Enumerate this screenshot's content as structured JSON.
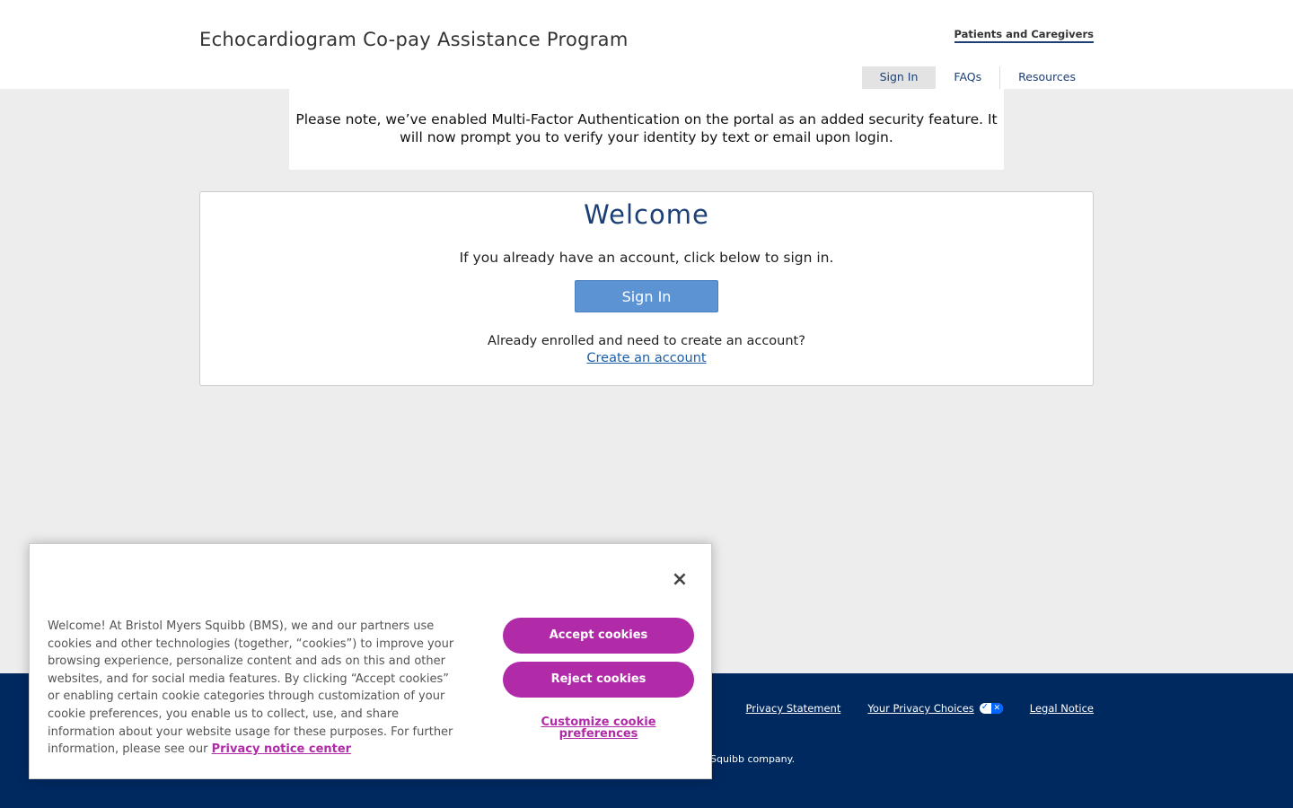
{
  "header": {
    "title": "Echocardiogram Co-pay Assistance Program",
    "audience_link": "Patients and Caregivers",
    "nav": [
      {
        "label": "Sign In",
        "active": true
      },
      {
        "label": "FAQs",
        "active": false
      },
      {
        "label": "Resources",
        "active": false
      }
    ]
  },
  "notice": {
    "text": "Please note, we’ve enabled Multi-Factor Authentication on the portal as an added security feature. It will now prompt you to verify your identity by text or email upon login."
  },
  "welcome": {
    "title": "Welcome",
    "intro": "If you already have an account, click below to sign in.",
    "sign_in_label": "Sign In",
    "enroll_text": "Already enrolled and need to create an account?",
    "create_account_label": "Create an account"
  },
  "footer": {
    "links": {
      "privacy_statement": "Privacy Statement",
      "privacy_choices": "Your Privacy Choices",
      "legal_notice": "Legal Notice"
    },
    "copyright_fragment": "Squibb company."
  },
  "cookie_banner": {
    "text": "Welcome! At Bristol Myers Squibb (BMS), we and our partners use cookies and other technologies (together, “cookies”) to improve your browsing experience, personalize content and ads on this and other websites, and for social media features. By clicking “Accept cookies” or enabling certain cookie categories through customization of your cookie preferences, you enable us to collect, use, and share information about your website usage for these purposes. For further information, please see our",
    "privacy_link": "Privacy notice center",
    "accept_label": "Accept cookies",
    "reject_label": "Reject cookies",
    "customize_label": "Customize cookie preferences",
    "close_icon": "×"
  },
  "colors": {
    "brand_navy": "#002960",
    "nav_text": "#1c3f75",
    "sign_in_button": "#5b93d3",
    "cookie_accent": "#b12aa8",
    "page_background": "#ededed"
  }
}
